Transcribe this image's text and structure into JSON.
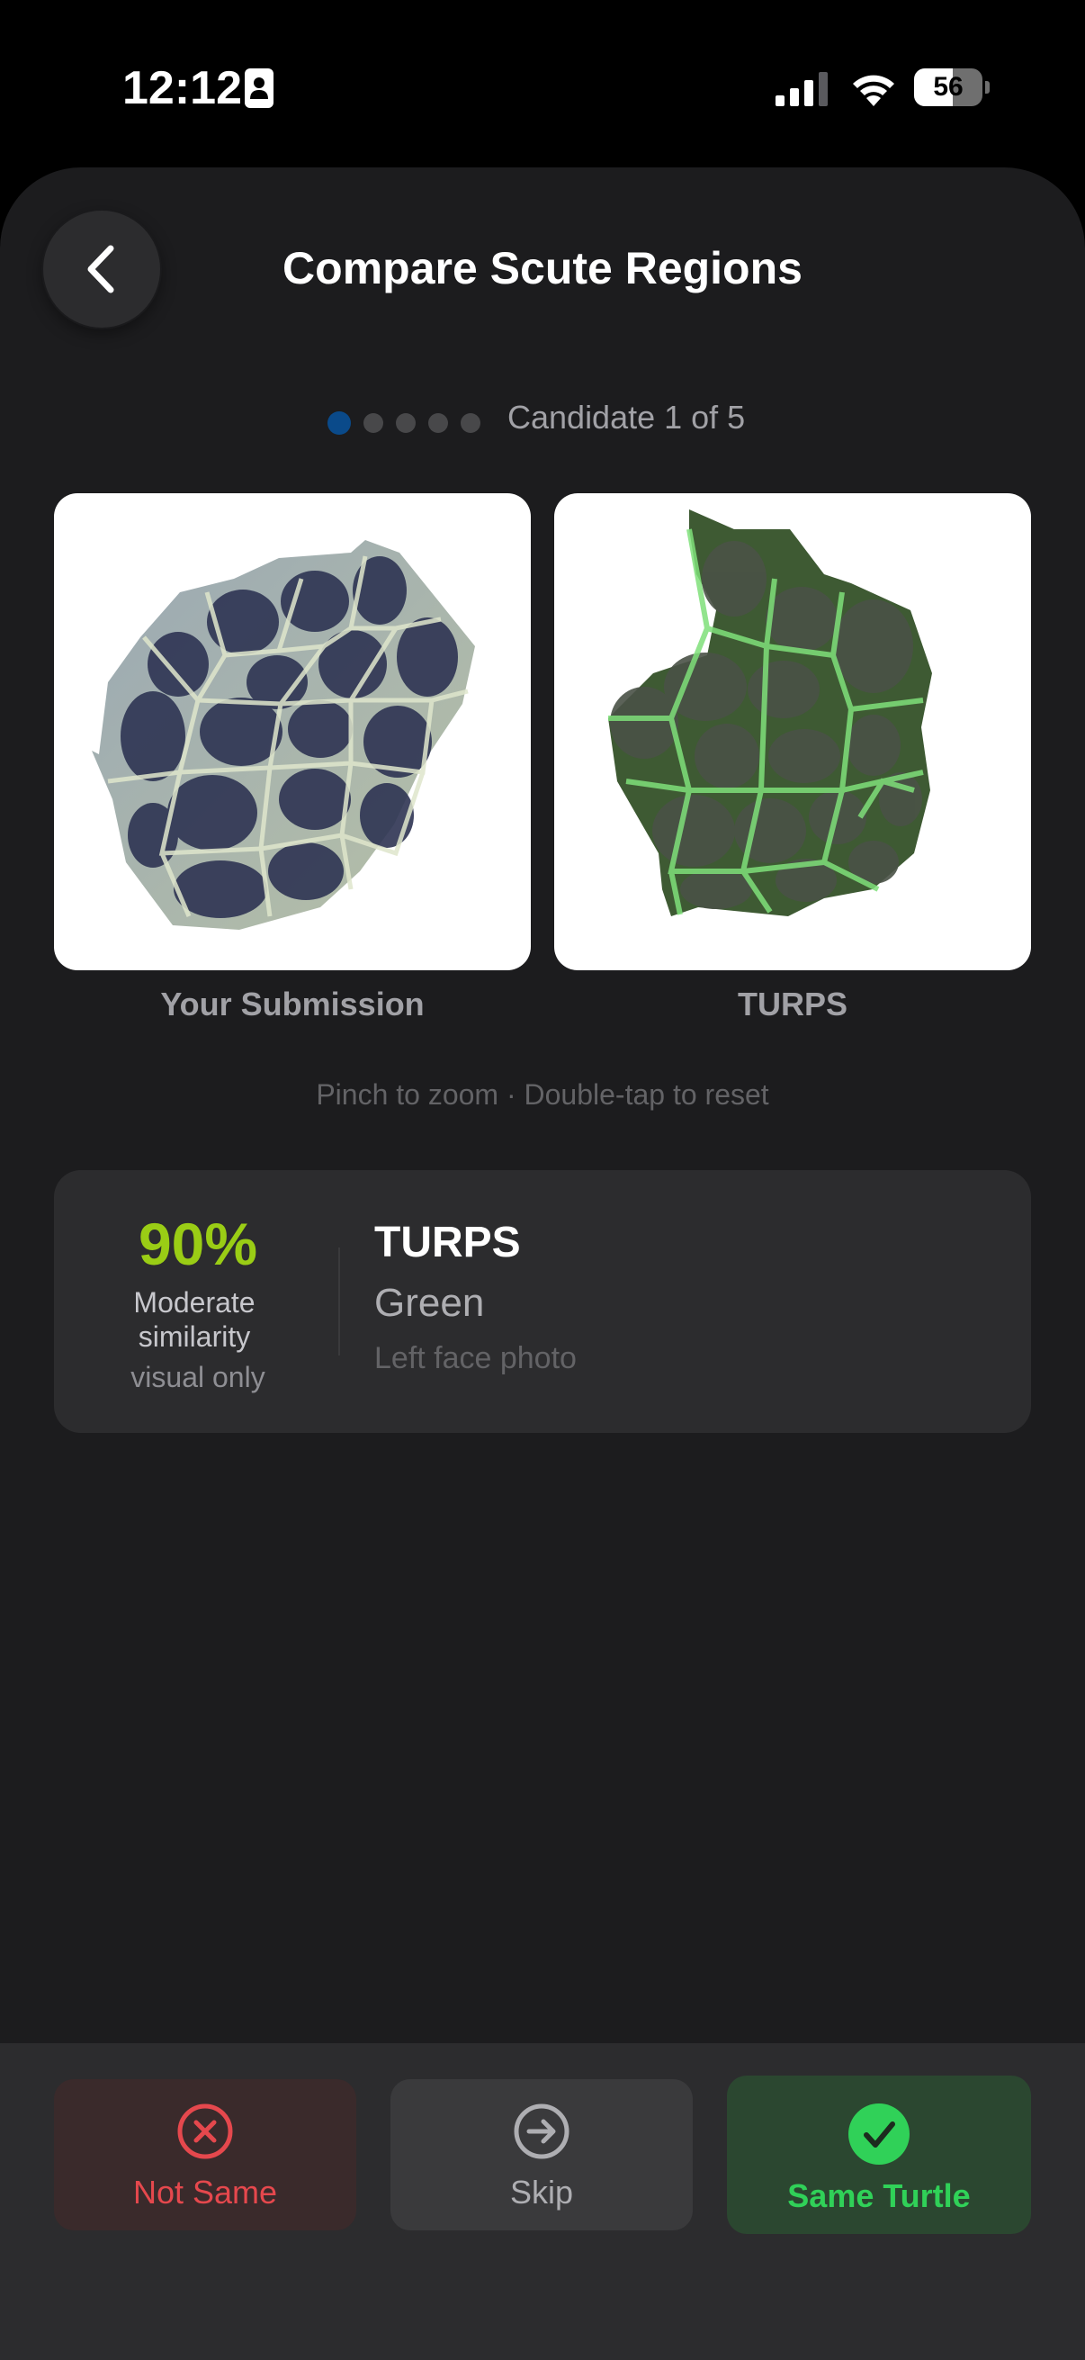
{
  "status_bar": {
    "time": "12:12",
    "battery_level": "56",
    "battery_fraction": 0.56,
    "icons": [
      "contact-card-icon",
      "cellular-signal-icon",
      "wifi-icon",
      "battery-icon"
    ]
  },
  "header": {
    "title": "Compare Scute Regions",
    "back_icon": "chevron-left-icon"
  },
  "pager": {
    "current": 1,
    "total": 5,
    "label": "Candidate 1 of 5"
  },
  "comparison": {
    "left_caption": "Your Submission",
    "right_caption": "TURPS",
    "hint": "Pinch to zoom · Double-tap to reset"
  },
  "match": {
    "percent": "90%",
    "similarity_label": "Moderate similarity",
    "similarity_note": "visual only",
    "name": "TURPS",
    "species": "Green",
    "photo_type": "Left face photo"
  },
  "actions": {
    "not_same": {
      "label": "Not Same",
      "icon": "x-circle-icon"
    },
    "skip": {
      "label": "Skip",
      "icon": "arrow-right-circle-icon"
    },
    "same": {
      "label": "Same Turtle",
      "icon": "checkmark-circle-icon"
    }
  },
  "colors": {
    "accent_green": "#30d158",
    "score_green": "#9acd15",
    "danger_red": "#e5484d",
    "pager_active": "#0a4a8a",
    "sheet_background": "#1c1c1e"
  }
}
